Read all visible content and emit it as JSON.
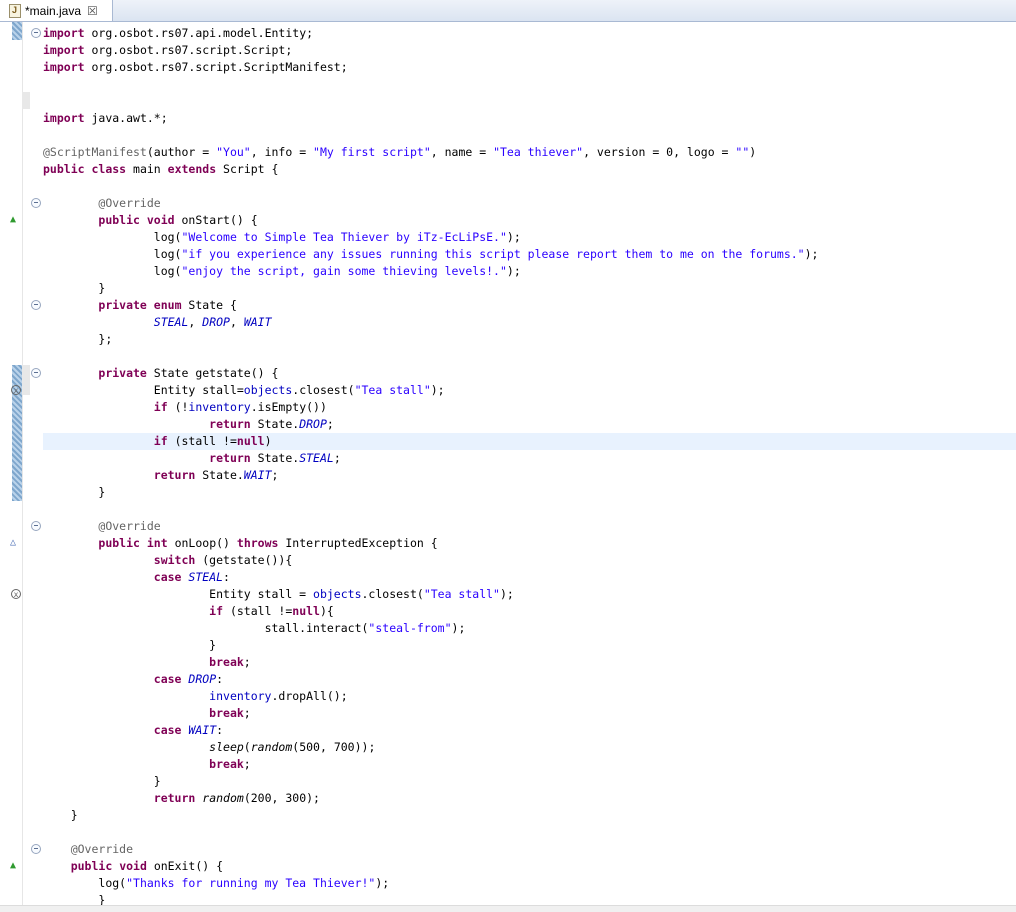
{
  "tab": {
    "title": "*main.java",
    "close_symbol": "☒",
    "icon": "java-file-icon"
  },
  "code": {
    "l1": "org.osbot.rs07.api.model.Entity;",
    "l2": "org.osbot.rs07.script.Script;",
    "l3": "org.osbot.rs07.script.ScriptManifest;",
    "l4": "java.awt.*;",
    "kw_import": "import",
    "manifest_ann": "@ScriptManifest",
    "m_a": "(author = ",
    "m_you": "\"You\"",
    "m_b": ", info = ",
    "m_info": "\"My first script\"",
    "m_c": ", name = ",
    "m_name": "\"Tea thiever\"",
    "m_d": ", version = 0, logo = ",
    "m_logo": "\"\"",
    "m_e": ")",
    "kw_public": "public",
    "kw_class": "class",
    "class_name": " main ",
    "kw_extends": "extends",
    "class_tail": " Script {",
    "override": "@Override",
    "kw_void": "void",
    "onstart_sig": " onStart() {",
    "log_open": "log(",
    "log_close": ");",
    "s_welcome": "\"Welcome to Simple Tea Thiever by iTz-EcLiPsE.\"",
    "s_issues": "\"if you experience any issues running this script please report them to me on the forums.\"",
    "s_enjoy": "\"enjoy the script, gain some thieving levels!.\"",
    "close_brace": "}",
    "kw_private": "private",
    "kw_enum": "enum",
    "enum_name": " State {",
    "enum_vals_steal": "STEAL",
    "enum_vals_drop": "DROP",
    "enum_vals_wait": "WAIT",
    "comma": ", ",
    "enum_end": "};",
    "getstate_sig": " State getstate() {",
    "entity_stall_eq": "Entity stall=",
    "objects": "objects",
    "closest_open": ".closest(",
    "s_tea_stall": "\"Tea stall\"",
    "kw_if": "if",
    "if_inv_a": " (!",
    "inventory": "inventory",
    "if_inv_b": ".isEmpty())",
    "kw_return": "return",
    "state_dot": " State.",
    "semi": ";",
    "if_stall_a": " (stall !=",
    "kw_null": "null",
    "paren_close": ")",
    "kw_int": "int",
    "onloop_sig": " onLoop() ",
    "kw_throws": "throws",
    "onloop_tail": " InterruptedException {",
    "kw_switch": "switch",
    "switch_tail": " (getstate()){",
    "kw_case": "case",
    "colon": ":",
    "entity_stall_sp": "Entity stall = ",
    "closest_tail": ");",
    "if_stall_b": " (stall !=",
    "brace_open_tail": "){",
    "stall_interact": "stall.interact(",
    "s_steal_from": "\"steal-from\"",
    "kw_break": "break",
    "drop_all": ".dropAll();",
    "sleep": "sleep",
    "random": "random",
    "sleep_args": "(500, 700)",
    "sleep_tail": ");",
    "return_args": "(200, 300);",
    "onexit_sig": " onExit() {",
    "s_thanks": "\"Thanks for running my Tea Thiever!\""
  }
}
